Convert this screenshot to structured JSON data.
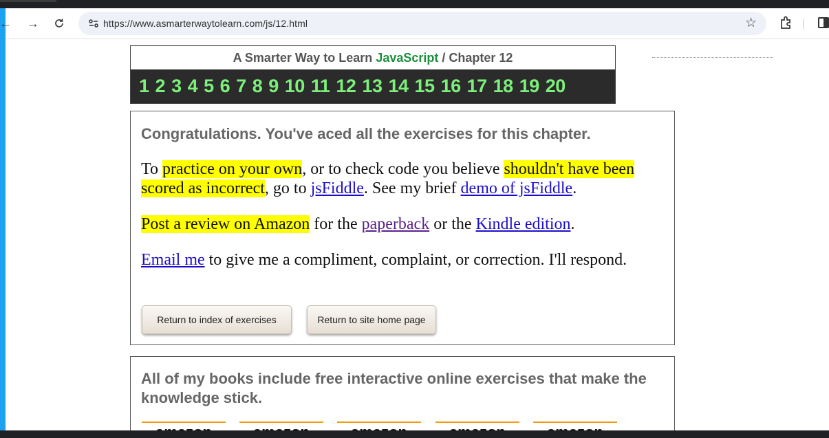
{
  "browser": {
    "url": "https://www.asmarterwaytolearn.com/js/12.html",
    "icons": [
      "back-arrow-icon",
      "forward-arrow-icon",
      "reload-icon",
      "site-settings-icon",
      "bookmark-star-icon",
      "extensions-icon",
      "side-panel-icon"
    ]
  },
  "header": {
    "title_prefix": "A Smarter Way to Learn",
    "title_brand": "JavaScript",
    "title_suffix": "/ Chapter 12",
    "brand_color": "#1a8f3c",
    "chapters": [
      "1",
      "2",
      "3",
      "4",
      "5",
      "6",
      "7",
      "8",
      "9",
      "10",
      "11",
      "12",
      "13",
      "14",
      "15",
      "16",
      "17",
      "18",
      "19",
      "20"
    ]
  },
  "congrats": {
    "heading": "Congratulations. You've aced all the exercises for this chapter.",
    "p1": {
      "t1": "To ",
      "hl1": "practice on your own",
      "t2": ", or to check code you believe ",
      "hl2": "shouldn't have been scored as incorrect",
      "t3": ", go to ",
      "link1": "jsFiddle",
      "t4": ". See my brief ",
      "link2": "demo of jsFiddle",
      "t5": "."
    },
    "p2": {
      "hl": "Post a review on Amazon",
      "t1": " for the ",
      "link1": "paperback",
      "t2": " or the ",
      "link2": "Kindle edition",
      "t3": "."
    },
    "p3": {
      "link": "Email me",
      "t1": " to give me a compliment, complaint, or correction. I'll respond."
    },
    "buttons": {
      "index": "Return to index of exercises",
      "home": "Return to site home page"
    }
  },
  "books": {
    "text": "All of my books include free interactive online exercises that make the knowledge stick.",
    "amazon_labels": [
      "amazon",
      "amazon",
      "amazon",
      "amazon",
      "amazon"
    ]
  }
}
